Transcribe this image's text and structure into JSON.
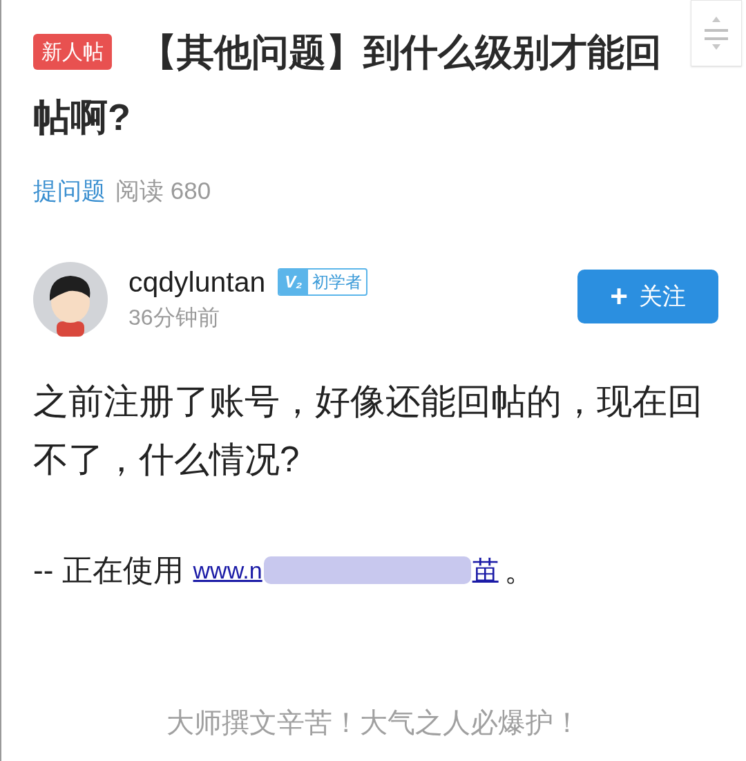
{
  "post": {
    "badge": "新人帖",
    "title_lines": [
      "【其他问题】到什么级别才能回",
      "帖啊?"
    ],
    "category": "提问题",
    "views": "阅读 680"
  },
  "author": {
    "name": "cqdyluntan",
    "level_icon": "V₂",
    "level_name": "初学者",
    "time": "36分钟前"
  },
  "follow_button": {
    "icon": "+",
    "label": "关注"
  },
  "body": {
    "paragraph": "之前注册了账号，好像还能回帖的，现在回不了，什么情况?",
    "signature_prefix": "-- 正在使用",
    "link_start": "www.n",
    "link_end": "苗",
    "signature_suffix": "。"
  },
  "footer": "大师撰文辛苦！大气之人必爆护！"
}
